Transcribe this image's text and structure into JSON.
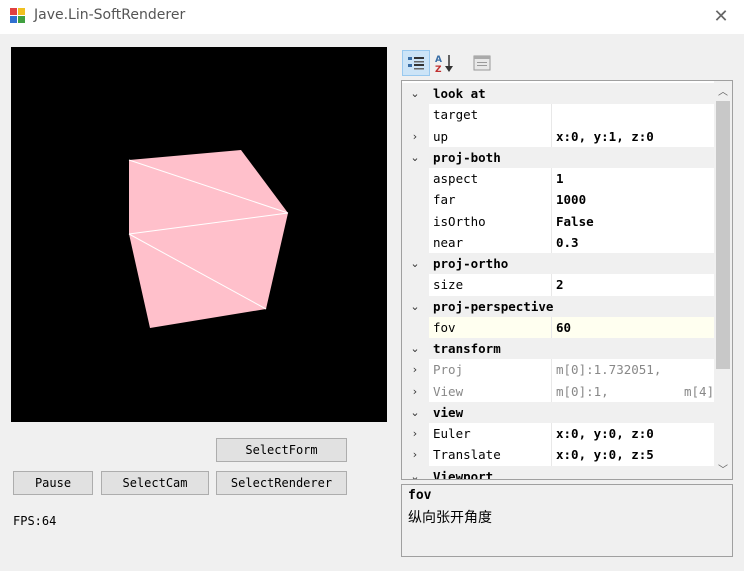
{
  "window": {
    "title": "Jave.Lin-SoftRenderer"
  },
  "icons": {
    "app": "app-icon",
    "close": "close-icon"
  },
  "cube_color": "#ffc0cb",
  "buttons": {
    "select_form": "SelectForm",
    "pause": "Pause",
    "select_cam": "SelectCam",
    "select_renderer": "SelectRenderer"
  },
  "status": {
    "fps": "FPS:64"
  },
  "toolbar": {
    "items": [
      "categorized-icon",
      "alphabetical-icon",
      "property-pages-icon"
    ]
  },
  "grid": {
    "rows": [
      {
        "type": "cat",
        "expander": "⌄",
        "name": "look at"
      },
      {
        "type": "prop",
        "expander": "",
        "name": "target",
        "value": ""
      },
      {
        "type": "prop",
        "expander": "›",
        "name": "up",
        "value": "x:0, y:1, z:0"
      },
      {
        "type": "cat",
        "expander": "⌄",
        "name": "proj-both"
      },
      {
        "type": "prop",
        "expander": "",
        "name": "aspect",
        "value": "1"
      },
      {
        "type": "prop",
        "expander": "",
        "name": "far",
        "value": "1000"
      },
      {
        "type": "prop",
        "expander": "",
        "name": "isOrtho",
        "value": "False"
      },
      {
        "type": "prop",
        "expander": "",
        "name": "near",
        "value": "0.3"
      },
      {
        "type": "cat",
        "expander": "⌄",
        "name": "proj-ortho"
      },
      {
        "type": "prop",
        "expander": "",
        "name": "size",
        "value": "2"
      },
      {
        "type": "cat",
        "expander": "⌄",
        "name": "proj-perspective"
      },
      {
        "type": "prop",
        "expander": "",
        "name": "fov",
        "value": "60"
      },
      {
        "type": "cat",
        "expander": "⌄",
        "name": "transform"
      },
      {
        "type": "ro",
        "expander": "›",
        "name": "Proj",
        "value": "m[0]:1.732051,",
        "value2": ""
      },
      {
        "type": "ro",
        "expander": "›",
        "name": "View",
        "value": "m[0]:1,",
        "value2": "m[4]"
      },
      {
        "type": "cat",
        "expander": "⌄",
        "name": "view"
      },
      {
        "type": "prop",
        "expander": "›",
        "name": "Euler",
        "value": "x:0, y:0, z:0"
      },
      {
        "type": "prop",
        "expander": "›",
        "name": "Translate",
        "value": "x:0, y:0, z:5"
      },
      {
        "type": "cat",
        "expander": "⌄",
        "name": "Viewport"
      }
    ]
  },
  "description": {
    "title": "fov",
    "text": "纵向张开角度"
  }
}
